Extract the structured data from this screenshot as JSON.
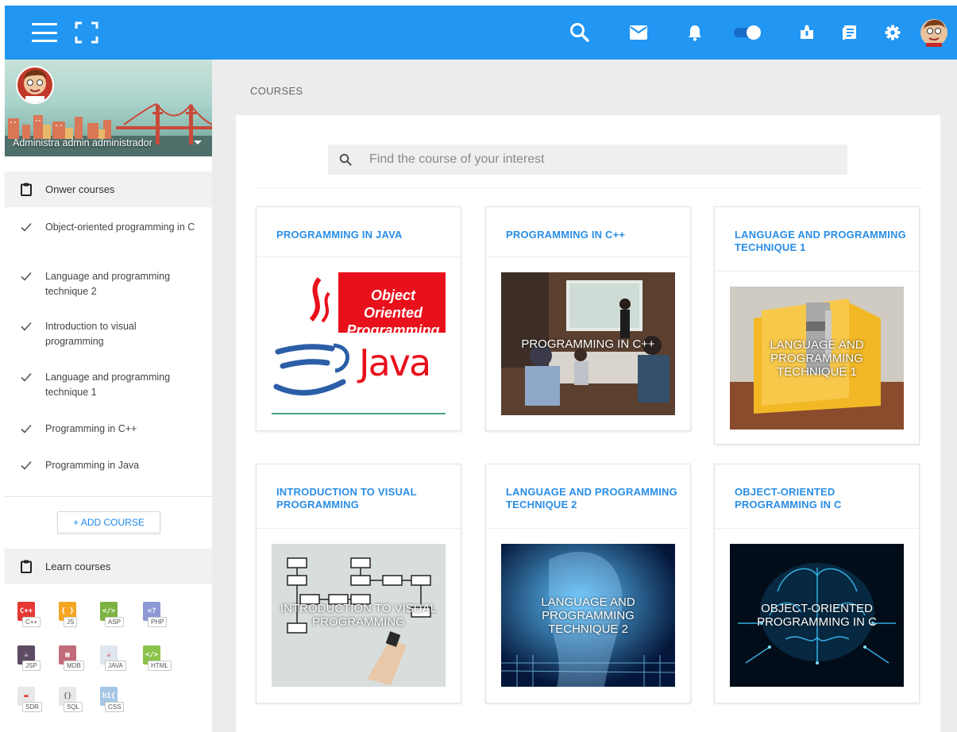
{
  "header": {
    "icons": [
      "menu-icon",
      "fullscreen-icon",
      "search-icon",
      "mail-icon",
      "bell-icon",
      "toggle-switch",
      "puzzle-icon",
      "notes-icon",
      "gear-icon",
      "user-avatar"
    ]
  },
  "sidebar": {
    "user_name": "Administra admin administrador",
    "owner_section": "Onwer courses",
    "owner_courses": [
      "Object-oriented programming in C",
      "Language and programming technique 2",
      "Introduction to visual programming",
      "Language and programming technique 1",
      "Programming in C++",
      "Programming in Java"
    ],
    "add_course_label": "+   ADD COURSE",
    "learn_section": "Learn courses",
    "learn_courses": [
      {
        "icon": "C++",
        "tag": "C++",
        "color": "#e53935"
      },
      {
        "icon": "{ }",
        "tag": "JS",
        "color": "#f5a623"
      },
      {
        "icon": "</>",
        "tag": "ASP",
        "color": "#7cb342"
      },
      {
        "icon": "<?",
        "tag": "PHP",
        "color": "#8e99d6"
      },
      {
        "icon": "☕",
        "tag": "JSP",
        "color": "#5d4a63"
      },
      {
        "icon": "▦",
        "tag": "MDB",
        "color": "#c26b7a"
      },
      {
        "icon": "☕",
        "tag": "JAVA",
        "color": "#dfe6ee"
      },
      {
        "icon": "</>",
        "tag": "HTML",
        "color": "#8bc34a"
      },
      {
        "icon": "▬",
        "tag": "SDR",
        "color": "#e8e8e8"
      },
      {
        "icon": "{}",
        "tag": "SQL",
        "color": "#e8e8e8"
      },
      {
        "icon": "h1{",
        "tag": "CSS",
        "color": "#a6c6e6"
      }
    ]
  },
  "main": {
    "breadcrumb": "COURSES",
    "search_placeholder": "Find the course of your interest",
    "cards": [
      {
        "title": "PROGRAMMING IN JAVA",
        "overlay": ""
      },
      {
        "title": "PROGRAMMING IN C++",
        "overlay": "PROGRAMMING IN C++"
      },
      {
        "title": "LANGUAGE AND PROGRAMMING TECHNIQUE 1",
        "overlay": "LANGUAGE AND PROGRAMMING TECHNIQUE 1"
      },
      {
        "title": "INTRODUCTION TO VISUAL PROGRAMMING",
        "overlay": "INTRODUCTION TO VISUAL PROGRAMMING"
      },
      {
        "title": "LANGUAGE AND PROGRAMMING TECHNIQUE 2",
        "overlay": "LANGUAGE AND PROGRAMMING TECHNIQUE 2"
      },
      {
        "title": "OBJECT-ORIENTED PROGRAMMING IN C",
        "overlay": "OBJECT-ORIENTED PROGRAMMING IN C"
      }
    ],
    "java_image_text": {
      "banner": "Object Oriented Programming",
      "word": "Java"
    }
  },
  "colors": {
    "topbar": "#2196f3",
    "accent": "#2a8ee6",
    "java_red": "#e8101b"
  }
}
